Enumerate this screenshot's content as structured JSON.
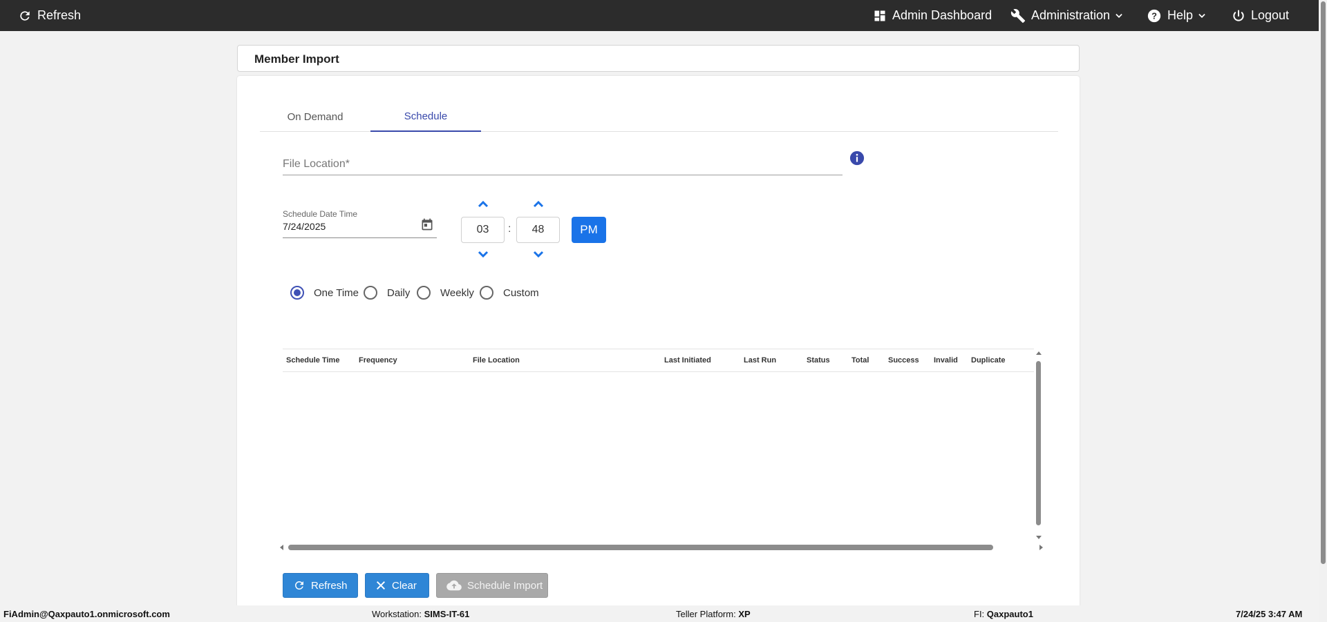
{
  "topbar": {
    "refresh_label": "Refresh",
    "admin_dashboard_label": "Admin Dashboard",
    "administration_label": "Administration",
    "help_label": "Help",
    "logout_label": "Logout"
  },
  "page": {
    "title": "Member Import"
  },
  "tabs": [
    {
      "label": "On Demand",
      "active": false
    },
    {
      "label": "Schedule",
      "active": true
    }
  ],
  "form": {
    "file_location_label": "File Location*",
    "file_location_value": "",
    "schedule_date_label": "Schedule Date Time",
    "schedule_date_value": "7/24/2025",
    "hour": "03",
    "minute": "48",
    "colon": ":",
    "meridiem": "PM"
  },
  "frequency_options": [
    {
      "label": "One Time",
      "checked": true
    },
    {
      "label": "Daily",
      "checked": false
    },
    {
      "label": "Weekly",
      "checked": false
    },
    {
      "label": "Custom",
      "checked": false
    }
  ],
  "grid": {
    "columns": [
      "Schedule Time",
      "Frequency",
      "File Location",
      "Last Initiated",
      "Last Run",
      "Status",
      "Total",
      "Success",
      "Invalid",
      "Duplicate"
    ],
    "rows": []
  },
  "buttons": {
    "refresh": "Refresh",
    "clear": "Clear",
    "schedule_import": "Schedule Import"
  },
  "footer": {
    "user": "FiAdmin@Qaxpauto1.onmicrosoft.com",
    "workstation_label": "Workstation: ",
    "workstation_value": "SIMS-IT-61",
    "platform_label": "Teller Platform: ",
    "platform_value": "XP",
    "fi_label": "FI: ",
    "fi_value": "Qaxpauto1",
    "datetime": "7/24/25 3:47 AM"
  },
  "colors": {
    "topbar": "#2c2c2c",
    "accent": "#3949ab",
    "primary_button": "#2f86d6",
    "pm_button": "#1a73e8",
    "disabled_button": "#a9a9a9"
  },
  "icons": {
    "refresh": "refresh-icon",
    "dashboard": "dashboard-icon",
    "administration": "wrench-icon",
    "help": "help-circle-icon",
    "logout": "power-icon",
    "info": "info-icon",
    "calendar": "calendar-icon",
    "clear": "close-icon",
    "schedule_import": "cloud-upload-icon"
  }
}
